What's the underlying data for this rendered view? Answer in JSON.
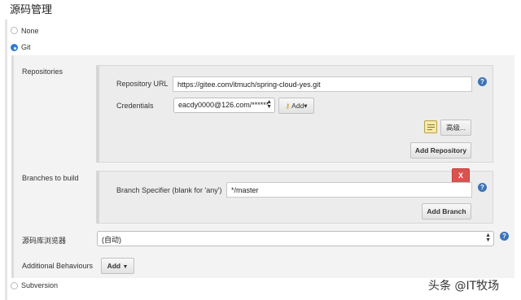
{
  "page": {
    "title": "源码管理"
  },
  "scm_options": {
    "none": "None",
    "git": "Git",
    "subversion": "Subversion"
  },
  "repositories": {
    "section_label": "Repositories",
    "url_label": "Repository URL",
    "url_value": "https://gitee.com/itmuch/spring-cloud-yes.git",
    "credentials_label": "Credentials",
    "credentials_value": "eacdy0000@126.com/******",
    "add_credentials_label": "Add",
    "advanced_label": "高级...",
    "add_repository_label": "Add Repository"
  },
  "branches": {
    "section_label": "Branches to build",
    "delete_label": "X",
    "specifier_label": "Branch Specifier (blank for 'any')",
    "specifier_value": "*/master",
    "add_branch_label": "Add Branch"
  },
  "browser": {
    "label": "源码库浏览器",
    "value": "(自动)"
  },
  "behaviours": {
    "label": "Additional Behaviours",
    "add_label": "Add"
  },
  "help_glyph": "?",
  "watermark": "头条 @IT牧场",
  "colors": {
    "accent": "#2e7bd8",
    "help": "#3d73b8",
    "delete": "#d9534f"
  }
}
